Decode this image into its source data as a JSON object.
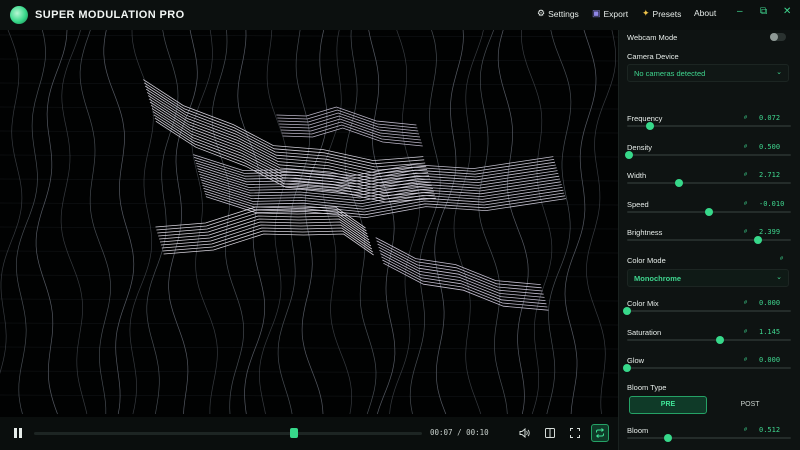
{
  "app": {
    "title": "SUPER MODULATION PRO"
  },
  "menu": [
    {
      "icon": "gear-icon",
      "glyph": "⚙",
      "label": "Settings"
    },
    {
      "icon": "export-icon",
      "glyph": "▣",
      "label": "Export"
    },
    {
      "icon": "sparkle-icon",
      "glyph": "✦",
      "label": "Presets"
    },
    {
      "label": "About"
    }
  ],
  "window_controls": {
    "minimize": "–",
    "maximize": "⧉",
    "close": "✕"
  },
  "transport": {
    "time": "00:07 / 00:10",
    "progress": 0.67
  },
  "sidebar": {
    "webcam_mode_label": "Webcam Mode",
    "webcam_mode_on": false,
    "camera_device_label": "Camera Device",
    "camera_device_value": "No cameras detected",
    "params": [
      {
        "name": "Frequency",
        "value": "0.072",
        "level": 0.14
      },
      {
        "name": "Density",
        "value": "0.500",
        "level": 0.01
      },
      {
        "name": "Width",
        "value": "2.712",
        "level": 0.32
      },
      {
        "name": "Speed",
        "value": "-0.010",
        "level": 0.5
      },
      {
        "name": "Brightness",
        "value": "2.399",
        "level": 0.8
      }
    ],
    "color_mode_label": "Color Mode",
    "color_mode_value": "Monochrome",
    "params2": [
      {
        "name": "Color Mix",
        "value": "0.000",
        "level": 0.0
      },
      {
        "name": "Saturation",
        "value": "1.145",
        "level": 0.57
      },
      {
        "name": "Glow",
        "value": "0.000",
        "level": 0.0
      }
    ],
    "bloom_type_label": "Bloom Type",
    "bloom_options": [
      "PRE",
      "POST"
    ],
    "bloom_selected": "PRE",
    "bloom": {
      "name": "Bloom",
      "value": "0.512",
      "level": 0.25
    }
  },
  "colors": {
    "accent": "#37d88a",
    "background": "#0e1312",
    "viewport": "#010202"
  }
}
